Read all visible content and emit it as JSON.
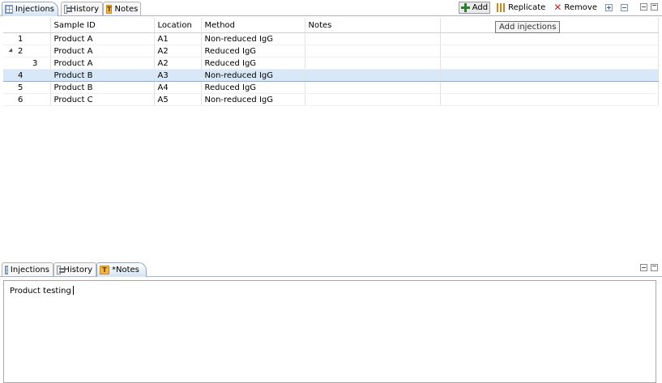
{
  "top": {
    "tabs": [
      {
        "label": "Injections",
        "icon": "grid-icon",
        "active": true
      },
      {
        "label": "History",
        "icon": "history-icon",
        "active": false
      },
      {
        "label": "Notes",
        "icon": "notes-icon",
        "active": false
      }
    ],
    "toolbar": {
      "add_label": "Add",
      "replicate_label": "Replicate",
      "remove_label": "Remove"
    },
    "tooltip": "Add injections",
    "columns": [
      "",
      "Sample ID",
      "Location",
      "Method",
      "Notes",
      ""
    ],
    "rows": [
      {
        "num": "1",
        "sample_id": "Product A",
        "location": "A1",
        "method": "Non-reduced IgG",
        "notes": "",
        "expanded": false,
        "child": false,
        "selected": false
      },
      {
        "num": "2",
        "sample_id": "Product A",
        "location": "A2",
        "method": "Reduced IgG",
        "notes": "",
        "expanded": true,
        "child": false,
        "selected": false
      },
      {
        "num": "3",
        "sample_id": "Product A",
        "location": "A2",
        "method": "Reduced IgG",
        "notes": "",
        "expanded": false,
        "child": true,
        "selected": false
      },
      {
        "num": "4",
        "sample_id": "Product B",
        "location": "A3",
        "method": "Non-reduced IgG",
        "notes": "",
        "expanded": false,
        "child": false,
        "selected": true
      },
      {
        "num": "5",
        "sample_id": "Product B",
        "location": "A4",
        "method": "Reduced IgG",
        "notes": "",
        "expanded": false,
        "child": false,
        "selected": false
      },
      {
        "num": "6",
        "sample_id": "Product C",
        "location": "A5",
        "method": "Non-reduced IgG",
        "notes": "",
        "expanded": false,
        "child": false,
        "selected": false
      }
    ]
  },
  "bottom": {
    "tabs": [
      {
        "label": "Injections",
        "icon": "grid-icon",
        "active": false
      },
      {
        "label": "History",
        "icon": "history-icon",
        "active": false
      },
      {
        "label": "*Notes",
        "icon": "notes-icon",
        "active": true
      }
    ],
    "notes_text": "Product testing"
  },
  "colors": {
    "selection": "#d9e8f8",
    "tab_active": "#d4e2f2",
    "add_icon": "#2f7d32",
    "remove_icon": "#c62828"
  }
}
